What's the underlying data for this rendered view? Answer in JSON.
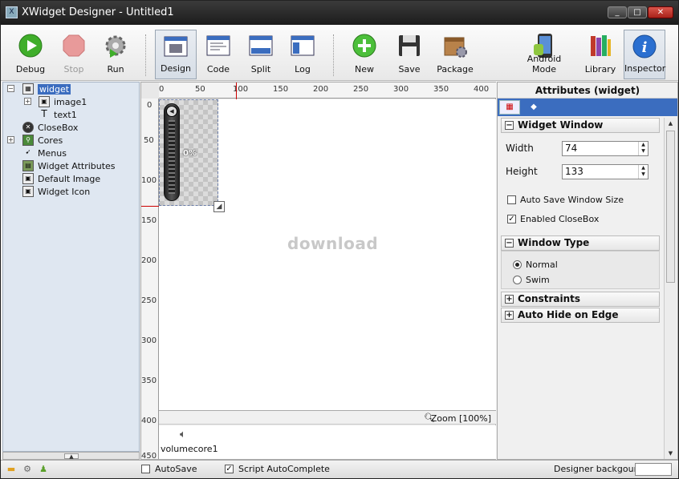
{
  "titlebar": {
    "title": "XWidget Designer - Untitled1"
  },
  "toolbar": {
    "debug": "Debug",
    "stop": "Stop",
    "run": "Run",
    "design": "Design",
    "code": "Code",
    "split": "Split",
    "log": "Log",
    "new": "New",
    "save": "Save",
    "package": "Package",
    "android_mode": "Android Mode",
    "library": "Library",
    "inspector": "Inspector"
  },
  "tree": {
    "items": [
      {
        "label": "widget"
      },
      {
        "label": "image1"
      },
      {
        "label": "text1"
      },
      {
        "label": "CloseBox"
      },
      {
        "label": "Cores"
      },
      {
        "label": "Menus"
      },
      {
        "label": "Widget Attributes"
      },
      {
        "label": "Default Image"
      },
      {
        "label": "Widget Icon"
      }
    ]
  },
  "ruler": {
    "top": [
      "0",
      "50",
      "100",
      "150",
      "200",
      "250",
      "300",
      "350",
      "400"
    ],
    "left": [
      "0",
      "50",
      "100",
      "150",
      "200",
      "250",
      "300",
      "350",
      "400",
      "450"
    ]
  },
  "canvas": {
    "percent": "0%",
    "watermark": "download",
    "zoom": "Zoom [100%]",
    "core_name": "volumecore1"
  },
  "inspector": {
    "header": "Attributes (widget)",
    "widget_window": "Widget Window",
    "width_label": "Width",
    "width_value": "74",
    "height_label": "Height",
    "height_value": "133",
    "auto_save": "Auto Save Window Size",
    "enabled_closebox": "Enabled CloseBox",
    "window_type": "Window Type",
    "normal": "Normal",
    "swim": "Swim",
    "constraints": "Constraints",
    "auto_hide": "Auto Hide on Edge"
  },
  "statusbar": {
    "autosave": "AutoSave",
    "script_autocomplete": "Script AutoComplete",
    "designer_background": "Designer backgound"
  },
  "colors": {
    "selection_blue": "#3b6dbf",
    "accent_red": "#cc0000"
  }
}
